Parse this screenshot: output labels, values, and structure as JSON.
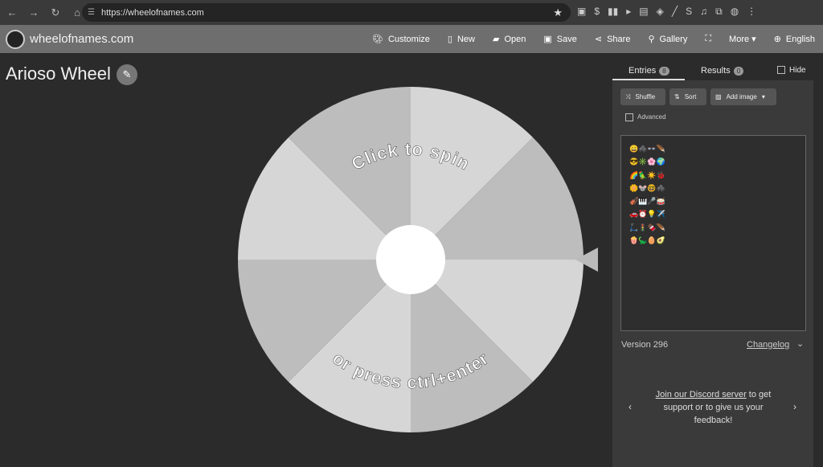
{
  "browser": {
    "url": "https://wheelofnames.com"
  },
  "app": {
    "brand": "wheelofnames.com",
    "menu": [
      {
        "icon": "palette-icon",
        "label": "Customize"
      },
      {
        "icon": "file-icon",
        "label": "New"
      },
      {
        "icon": "folder-icon",
        "label": "Open"
      },
      {
        "icon": "save-icon",
        "label": "Save"
      },
      {
        "icon": "share-icon",
        "label": "Share"
      },
      {
        "icon": "search-icon",
        "label": "Gallery"
      },
      {
        "icon": "fullscreen-icon",
        "label": ""
      },
      {
        "icon": "caret-down-icon",
        "label": "More"
      },
      {
        "icon": "globe-icon",
        "label": "English"
      }
    ]
  },
  "wheel": {
    "title": "Arioso Wheel",
    "top_text": "Click to spin",
    "bottom_text": "or press ctrl+enter",
    "slice_count": 8,
    "colors": [
      "#d6d6d6",
      "#bdbdbd"
    ]
  },
  "sidebar": {
    "tabs": [
      {
        "label": "Entries",
        "count": "8"
      },
      {
        "label": "Results",
        "count": "0"
      }
    ],
    "hide_label": "Hide",
    "shuffle": "Shuffle",
    "sort": "Sort",
    "add_image": "Add image",
    "advanced": "Advanced",
    "entries": [
      "😀🕷️👓🪶",
      "😎✳️🌸🌍",
      "🌈🦜☀️🐞",
      "🌼🐭🤓🕷️",
      "🎻🎹🎤🥁",
      "🚗⏰💡✈️",
      "🛴🚦🍫🪶",
      "🍿🦕🥚🥑"
    ],
    "version": "Version 296",
    "changelog": "Changelog",
    "discord_link": "Join our Discord server",
    "discord_rest": " to get support or to give us your feedback!"
  }
}
